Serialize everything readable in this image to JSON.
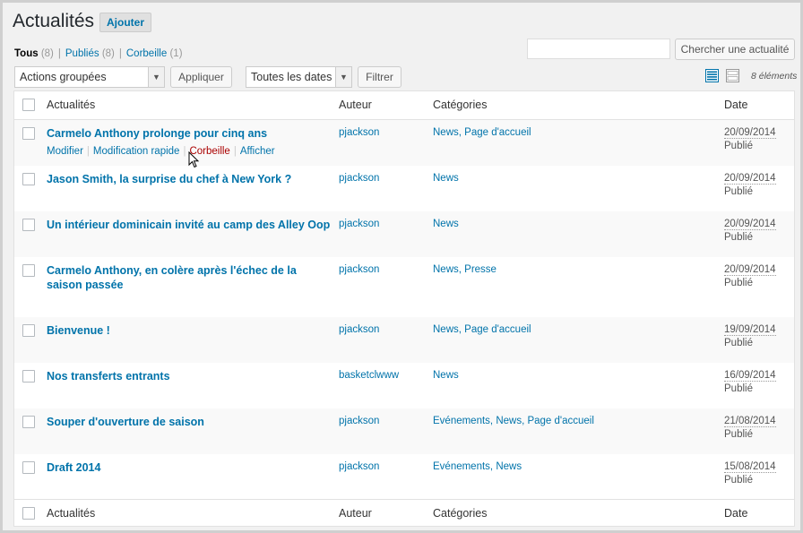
{
  "page": {
    "title": "Actualités",
    "add_label": "Ajouter"
  },
  "filters": {
    "all_label": "Tous",
    "all_count": "(8)",
    "published_label": "Publiés",
    "published_count": "(8)",
    "trash_label": "Corbeille",
    "trash_count": "(1)"
  },
  "search": {
    "value": "",
    "button_label": "Chercher une actualité"
  },
  "toolbar": {
    "bulk_actions": "Actions groupées",
    "apply_label": "Appliquer",
    "dates": "Toutes les dates",
    "filter_label": "Filtrer",
    "items_count": "8 éléments"
  },
  "table": {
    "headers": {
      "title": "Actualités",
      "author": "Auteur",
      "categories": "Catégories",
      "date": "Date"
    },
    "row_actions": {
      "edit": "Modifier",
      "quick_edit": "Modification rapide",
      "trash": "Corbeille",
      "view": "Afficher"
    },
    "rows": [
      {
        "title": "Carmelo Anthony prolonge pour cinq ans",
        "author": "pjackson",
        "categories": "News, Page d'accueil",
        "date": "20/09/2014",
        "status": "Publié"
      },
      {
        "title": "Jason Smith, la surprise du chef à New York ?",
        "author": "pjackson",
        "categories": "News",
        "date": "20/09/2014",
        "status": "Publié"
      },
      {
        "title": "Un intérieur dominicain invité au camp des Alley Oop",
        "author": "pjackson",
        "categories": "News",
        "date": "20/09/2014",
        "status": "Publié"
      },
      {
        "title": "Carmelo Anthony, en colère après l'échec de la saison passée",
        "author": "pjackson",
        "categories": "News, Presse",
        "date": "20/09/2014",
        "status": "Publié"
      },
      {
        "title": "Bienvenue !",
        "author": "pjackson",
        "categories": "News, Page d'accueil",
        "date": "19/09/2014",
        "status": "Publié"
      },
      {
        "title": "Nos transferts entrants",
        "author": "basketclwww",
        "categories": "News",
        "date": "16/09/2014",
        "status": "Publié"
      },
      {
        "title": "Souper d'ouverture de saison",
        "author": "pjackson",
        "categories": "Evénements, News, Page d'accueil",
        "date": "21/08/2014",
        "status": "Publié"
      },
      {
        "title": "Draft 2014",
        "author": "pjackson",
        "categories": "Evénements, News",
        "date": "15/08/2014",
        "status": "Publié"
      }
    ]
  },
  "icons": {
    "list_view": "list-view-icon",
    "excerpt_view": "excerpt-view-icon",
    "accent_color": "#0073aa"
  }
}
